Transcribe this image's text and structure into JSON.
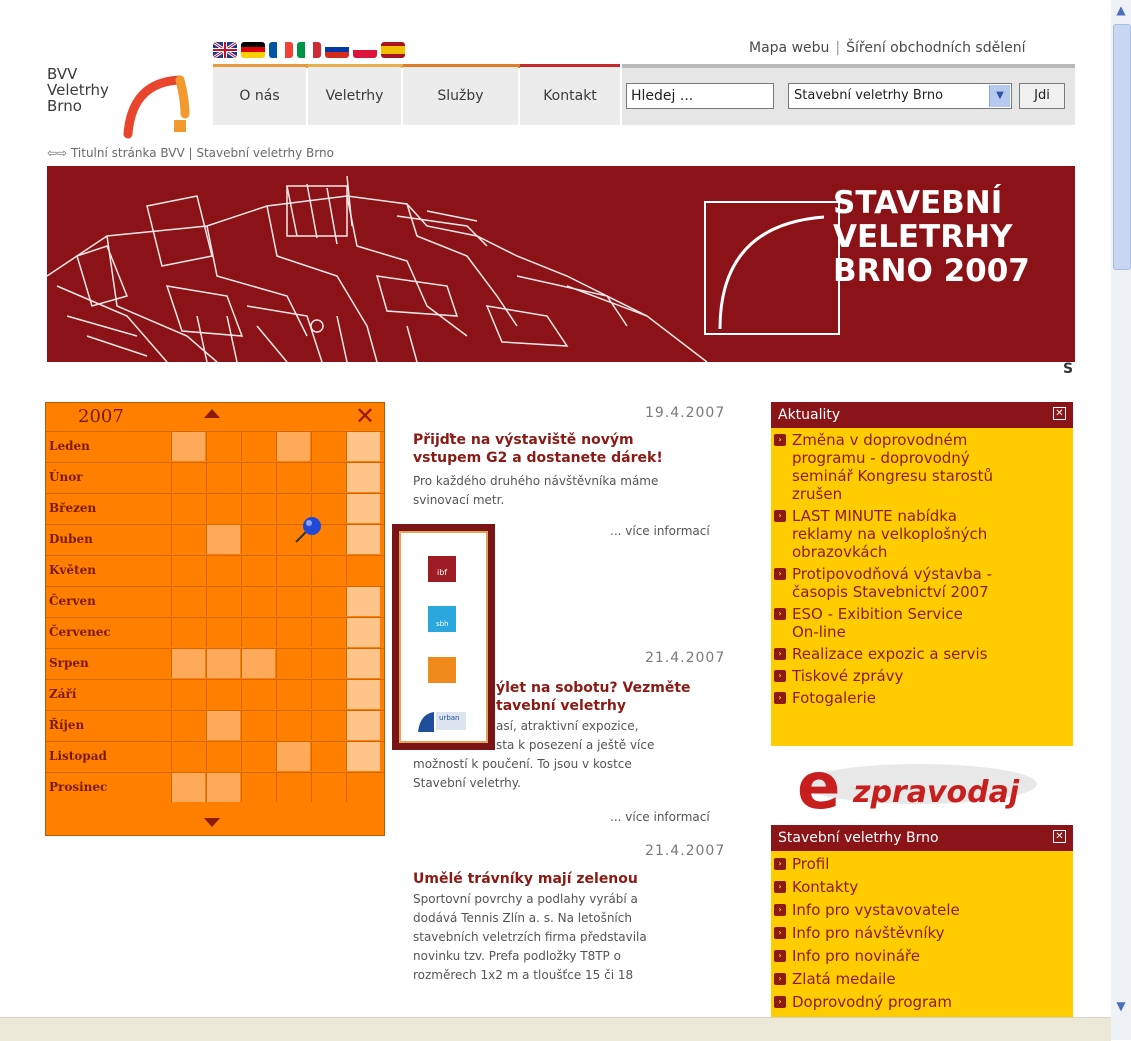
{
  "header": {
    "logo_lines": [
      "BVV",
      "Veletrhy",
      "Brno"
    ],
    "top_links": [
      "Mapa webu",
      "Šíření obchodních sdělení"
    ],
    "nav": [
      "O nás",
      "Veletrhy",
      "Služby",
      "Kontakt"
    ],
    "search_value": "Hledej ...",
    "fair_select_value": "Stavební veletrhy Brno",
    "go_label": "Jdi",
    "flags": [
      "uk-flag-icon",
      "german-flag-icon",
      "french-flag-icon",
      "italian-flag-icon",
      "russian-flag-icon",
      "polish-flag-icon",
      "spanish-flag-icon"
    ]
  },
  "breadcrumb": [
    "Titulní stránka BVV",
    "Stavební veletrhy Brno"
  ],
  "banner": {
    "title_lines": [
      "STAVEBNÍ",
      "VELETRHY",
      "BRNO 2007"
    ],
    "cut_letter": "S",
    "color": "#8b1216"
  },
  "calendar": {
    "year": "2007",
    "months": [
      "Leden",
      "Únor",
      "Březen",
      "Duben",
      "Květen",
      "Červen",
      "Červenec",
      "Srpen",
      "Září",
      "Říjen",
      "Listopad",
      "Prosinec"
    ]
  },
  "news": [
    {
      "date": "19.4.2007",
      "title_lines": [
        "Přijďte na výstaviště novým",
        "vstupem G2 a dostanete dárek!"
      ],
      "body_lines": [
        "Pro každého druhého návštěvníka máme",
        "svinovací metr."
      ],
      "more": "... více informací"
    },
    {
      "date": "21.4.2007",
      "title_lines": [
        "ýlet na sobotu? Vezměte",
        "tavební veletrhy"
      ],
      "body_lines": [
        "así, atraktivní expozice,",
        "sta k posezení a ještě více",
        "možností k poučení. To jsou v kostce",
        "Stavební veletrhy."
      ],
      "more": "... více informací"
    },
    {
      "date": "21.4.2007",
      "title_lines": [
        "Umělé trávníky mají zelenou"
      ],
      "body_lines": [
        "Sportovní povrchy a podlahy vyrábí a",
        "dodává Tennis Zlín a. s. Na letošních",
        "stavebních veletrzích firma představila",
        "novinku tzv. Prefa podložky T8TP o",
        "rozměrech 1x2 m a tloušťce 15 či 18"
      ]
    }
  ],
  "popup_logos": [
    "ibf",
    "sbh",
    "",
    "urban"
  ],
  "aktuality": {
    "title": "Aktuality",
    "items": [
      [
        "Změna v doprovodném",
        "programu - doprovodný",
        "seminář Kongresu starostů",
        "zrušen"
      ],
      [
        "LAST MINUTE nabídka",
        "reklamy na velkoplošných",
        "obrazovkách"
      ],
      [
        "Protipovodňová výstavba -",
        "časopis Stavebnictví 2007"
      ],
      [
        "ESO - Exibition Service",
        "On-line"
      ],
      [
        "Realizace expozic a servis"
      ],
      [
        "Tiskové zprávy"
      ],
      [
        "Fotogalerie"
      ]
    ]
  },
  "ezpravodaj": {
    "e": "e",
    "text": "zpravodaj"
  },
  "fair_box": {
    "title": "Stavební veletrhy Brno",
    "items": [
      "Profil",
      "Kontakty",
      "Info pro vystavovatele",
      "Info pro návštěvníky",
      "Info pro novináře",
      "Zlatá medaile",
      "Doprovodný program"
    ]
  },
  "colors": {
    "accent": "#8b1a14",
    "orange": "#ff8000",
    "yellow": "#ffcc00"
  }
}
